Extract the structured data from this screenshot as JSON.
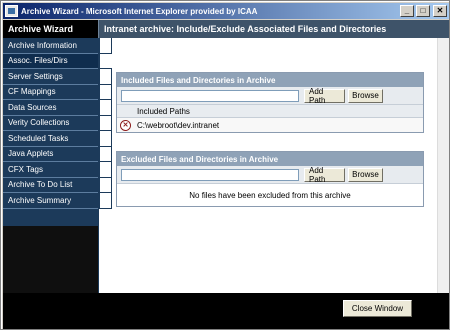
{
  "window": {
    "title": "Archive Wizard - Microsoft Internet Explorer provided by ICAA",
    "controls": {
      "minimize": "_",
      "maximize": "□",
      "close": "✕"
    }
  },
  "wizard": {
    "header": "Archive Wizard",
    "page_title": "Intranet archive: Include/Exclude Associated Files and Directories"
  },
  "sidebar": {
    "items": [
      {
        "label": "Archive Information"
      },
      {
        "label": "Assoc. Files/Dirs"
      },
      {
        "label": "Server Settings"
      },
      {
        "label": "CF Mappings"
      },
      {
        "label": "Data Sources"
      },
      {
        "label": "Verity Collections"
      },
      {
        "label": "Scheduled Tasks"
      },
      {
        "label": "Java Applets"
      },
      {
        "label": "CFX Tags"
      },
      {
        "label": "Archive To Do List"
      },
      {
        "label": "Archive Summary"
      }
    ],
    "active_index": 1
  },
  "included": {
    "heading": "Included Files and Directories in Archive",
    "input_value": "",
    "add_label": "Add Path",
    "browse_label": "Browse",
    "column_header": "Included Paths",
    "paths": [
      "C:\\webroot\\dev.intranet"
    ]
  },
  "excluded": {
    "heading": "Excluded Files and Directories in Archive",
    "input_value": "",
    "add_label": "Add Path",
    "browse_label": "Browse",
    "empty_message": "No files have been excluded from this archive"
  },
  "footer": {
    "close_label": "Close Window"
  },
  "icons": {
    "delete": "delete-icon"
  }
}
